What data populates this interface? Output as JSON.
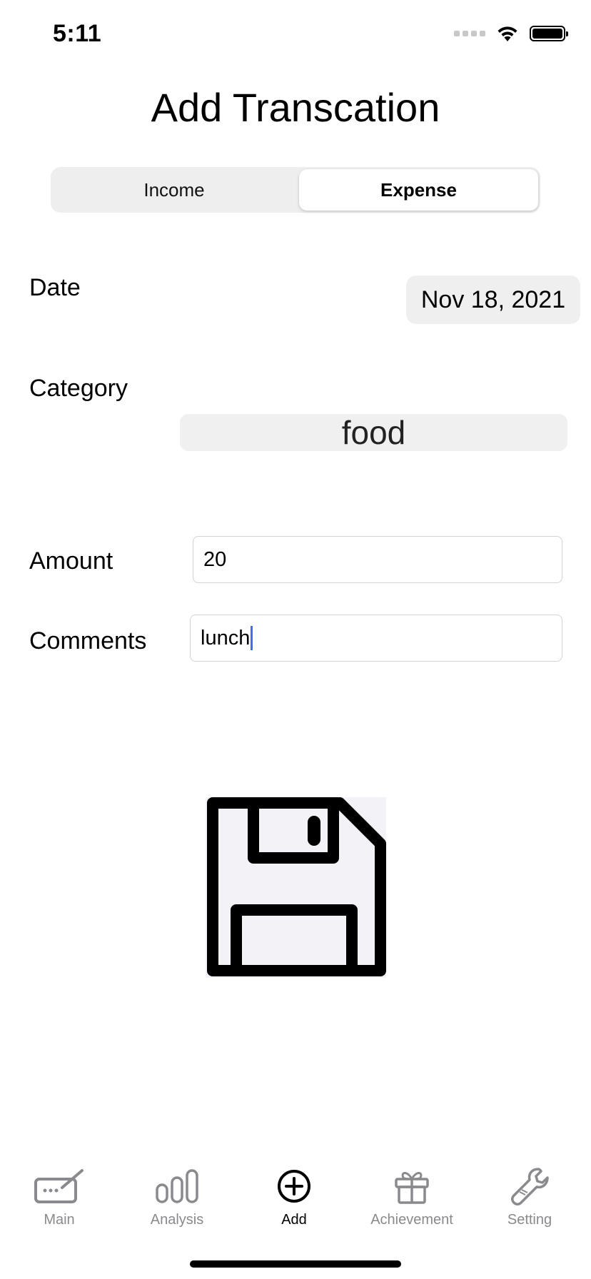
{
  "status_bar": {
    "time": "5:11"
  },
  "header": {
    "title": "Add Transcation"
  },
  "segmented": {
    "options": [
      "Income",
      "Expense"
    ],
    "selected": "Expense"
  },
  "form": {
    "date_label": "Date",
    "date_value": "Nov 18, 2021",
    "category_label": "Category",
    "category_value": "food",
    "amount_label": "Amount",
    "amount_value": "20",
    "comments_label": "Comments",
    "comments_value": "lunch"
  },
  "save": {
    "icon": "floppy-disk-icon",
    "icon_fill": "#f2f2f7",
    "icon_stroke": "#000000"
  },
  "tabbar": {
    "items": [
      {
        "label": "Main",
        "icon": "keyboard-pen-icon"
      },
      {
        "label": "Analysis",
        "icon": "bar-chart-icon"
      },
      {
        "label": "Add",
        "icon": "plus-circle-icon"
      },
      {
        "label": "Achievement",
        "icon": "gift-icon"
      },
      {
        "label": "Setting",
        "icon": "wrench-icon"
      }
    ],
    "active": "Add",
    "inactive_color": "#8a8a8e",
    "active_color": "#000000"
  }
}
